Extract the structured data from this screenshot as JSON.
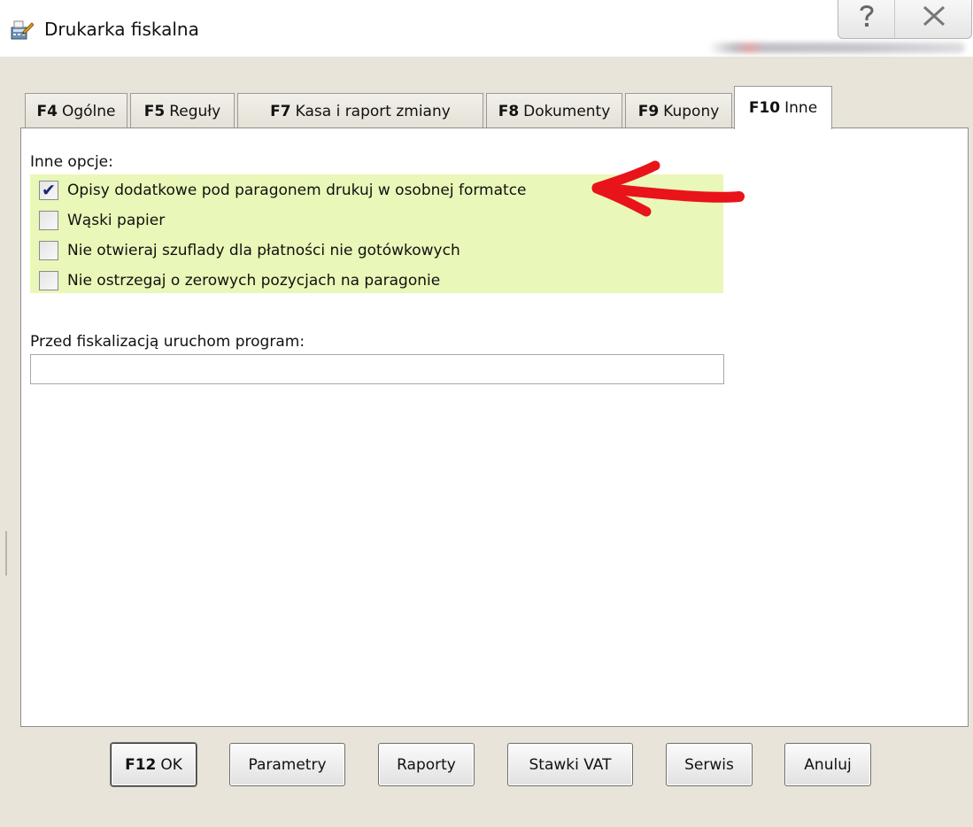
{
  "window": {
    "title": "Drukarka fiskalna"
  },
  "title_buttons": {
    "help": "?",
    "close": "✕"
  },
  "tabs": [
    {
      "key": "F4",
      "label": "Ogólne",
      "active": false
    },
    {
      "key": "F5",
      "label": "Reguły",
      "active": false
    },
    {
      "key": "F7",
      "label": "Kasa i raport zmiany",
      "active": false
    },
    {
      "key": "F8",
      "label": "Dokumenty",
      "active": false
    },
    {
      "key": "F9",
      "label": "Kupony",
      "active": false
    },
    {
      "key": "F10",
      "label": "Inne",
      "active": true
    }
  ],
  "panel": {
    "options_heading": "Inne opcje:",
    "options": [
      {
        "label": "Opisy dodatkowe pod paragonem drukuj w osobnej formatce",
        "checked": true
      },
      {
        "label": "Wąski papier",
        "checked": false
      },
      {
        "label": "Nie otwieraj szuflady dla płatności nie gotówkowych",
        "checked": false
      },
      {
        "label": "Nie ostrzegaj o zerowych pozycjach na paragonie",
        "checked": false
      }
    ],
    "program_label": "Przed fiskalizacją uruchom program:",
    "program_value": ""
  },
  "buttons": {
    "ok_key": "F12",
    "ok_label": "OK",
    "parametry": "Parametry",
    "raporty": "Raporty",
    "stawki_vat": "Stawki VAT",
    "serwis": "Serwis",
    "anuluj": "Anuluj"
  },
  "colors": {
    "options_highlight": "#e9f7b8",
    "annotation_arrow": "#e8141a",
    "window_background": "#e8e4da"
  }
}
